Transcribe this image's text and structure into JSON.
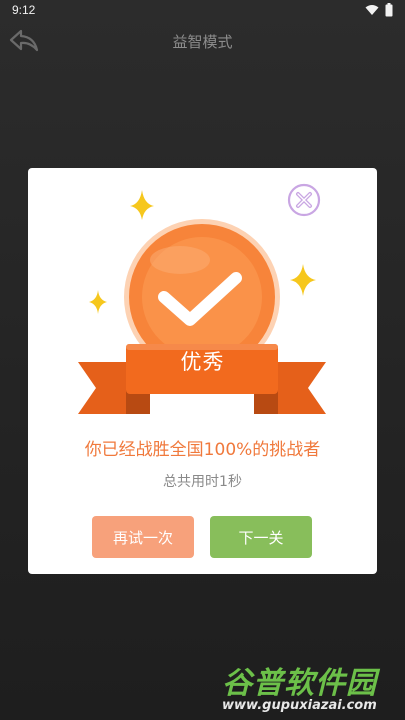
{
  "status_bar": {
    "time": "9:12"
  },
  "header": {
    "title": "益智模式"
  },
  "dialog": {
    "medal_label": "优秀",
    "result_message": "你已经战胜全国100%的挑战者",
    "time_used": "总共用时1秒",
    "retry_label": "再试一次",
    "next_label": "下一关"
  },
  "watermark": {
    "title": "谷普软件园",
    "url": "www.gupuxiazai.com"
  },
  "colors": {
    "medal_orange": "#f7843a",
    "ribbon": "#f26a1e",
    "star": "#f6c71d",
    "message": "#f0793c",
    "retry_button": "#f7a17b",
    "next_button": "#88be5b",
    "close_icon": "#c9a6e3"
  }
}
